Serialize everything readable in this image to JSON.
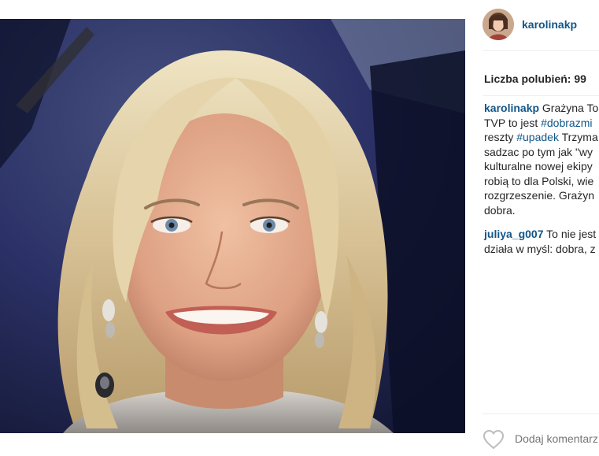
{
  "post": {
    "photo_alt": "",
    "author": {
      "username": "karolinakp"
    },
    "likes_text": "Liczba polubień: 99",
    "comments": [
      {
        "username": "karolinakp",
        "lines": [
          [
            {
              "t": "text",
              "v": "Grażyna To"
            }
          ],
          [
            {
              "t": "text",
              "v": "TVP to jest "
            },
            {
              "t": "tag",
              "v": "#dobrazmi"
            }
          ],
          [
            {
              "t": "text",
              "v": "reszty "
            },
            {
              "t": "tag",
              "v": "#upadek"
            },
            {
              "t": "text",
              "v": " Trzyma"
            }
          ],
          [
            {
              "t": "text",
              "v": "sadzac po tym jak \"wy"
            }
          ],
          [
            {
              "t": "text",
              "v": "kulturalne nowej ekipy"
            }
          ],
          [
            {
              "t": "text",
              "v": "robią to dla Polski, wie"
            }
          ],
          [
            {
              "t": "text",
              "v": "rozgrzeszenie. Grażyn"
            }
          ],
          [
            {
              "t": "text",
              "v": "dobra."
            }
          ]
        ]
      },
      {
        "username": "juliya_g007",
        "lines": [
          [
            {
              "t": "text",
              "v": "To nie jest"
            }
          ],
          [
            {
              "t": "text",
              "v": "działa w myśl: dobra, z"
            }
          ]
        ]
      }
    ],
    "actions": {
      "like_icon": "heart-outline-icon",
      "add_comment_placeholder": "Dodaj komentarz"
    }
  },
  "colors": {
    "link": "#125688",
    "text": "#262626",
    "muted": "#999999",
    "divider": "#efefef"
  }
}
